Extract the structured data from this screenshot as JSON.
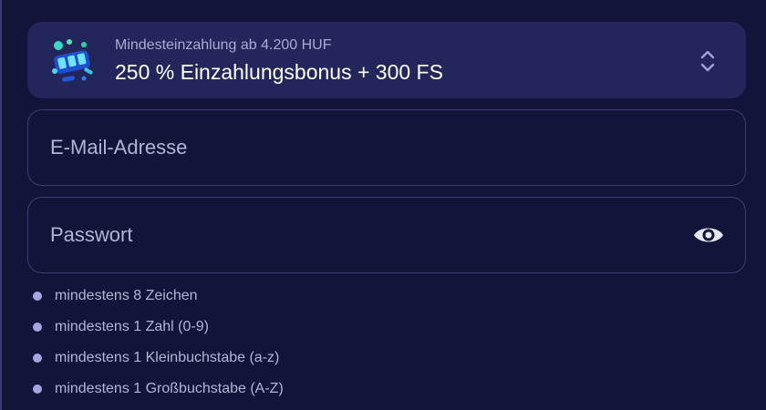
{
  "bonus": {
    "min_deposit": "Mindesteinzahlung ab 4.200 HUF",
    "title": "250 % Einzahlungsbonus + 300 FS",
    "icon": "slot-machine-icon"
  },
  "email": {
    "placeholder": "E-Mail-Adresse"
  },
  "password": {
    "placeholder": "Passwort",
    "toggle_icon": "eye-icon"
  },
  "password_rules": [
    "mindestens 8 Zeichen",
    "mindestens 1 Zahl (0-9)",
    "mindestens 1 Kleinbuchstabe (a-z)",
    "mindestens 1 Großbuchstabe (A-Z)"
  ],
  "colors": {
    "background": "#13143a",
    "card": "#23265a",
    "border": "#3b3e70",
    "muted_text": "#b2b4d4",
    "bullet": "#a7a4e0"
  }
}
